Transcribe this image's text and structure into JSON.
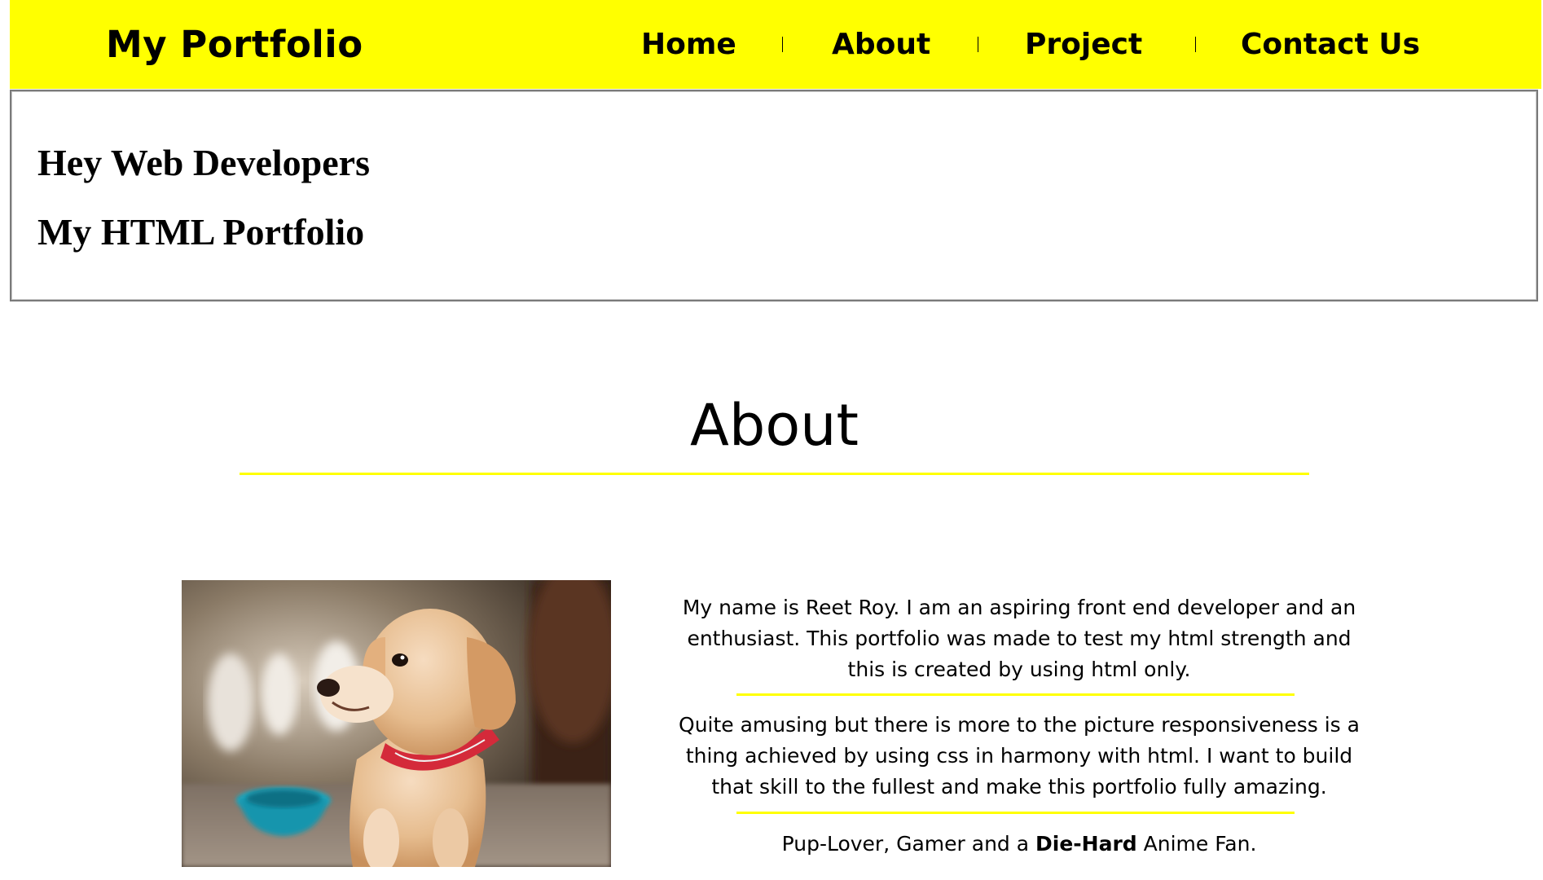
{
  "nav": {
    "brand": "My Portfolio",
    "links": [
      "Home",
      "About",
      "Project",
      "Contact Us"
    ]
  },
  "hero": {
    "line1": "Hey Web Developers",
    "line2": "My HTML Portfolio"
  },
  "about": {
    "title": "About",
    "paragraph1": "My name is Reet Roy. I am an aspiring front end developer and an enthusiast. This portfolio was made to test my html strength and this is created by using html only.",
    "paragraph2": "Quite amusing but there is more to the picture responsiveness is a thing achieved by using css in harmony with html. I want to build that skill to the fullest and make this portfolio fully amazing.",
    "paragraph3": {
      "before": "Pup-Lover, Gamer and a ",
      "bold": "Die-Hard",
      "after": " Anime Fan."
    },
    "image_subject": "puppy-photo"
  },
  "colors": {
    "accent": "#ffff00",
    "text": "#000000",
    "background": "#ffffff"
  }
}
